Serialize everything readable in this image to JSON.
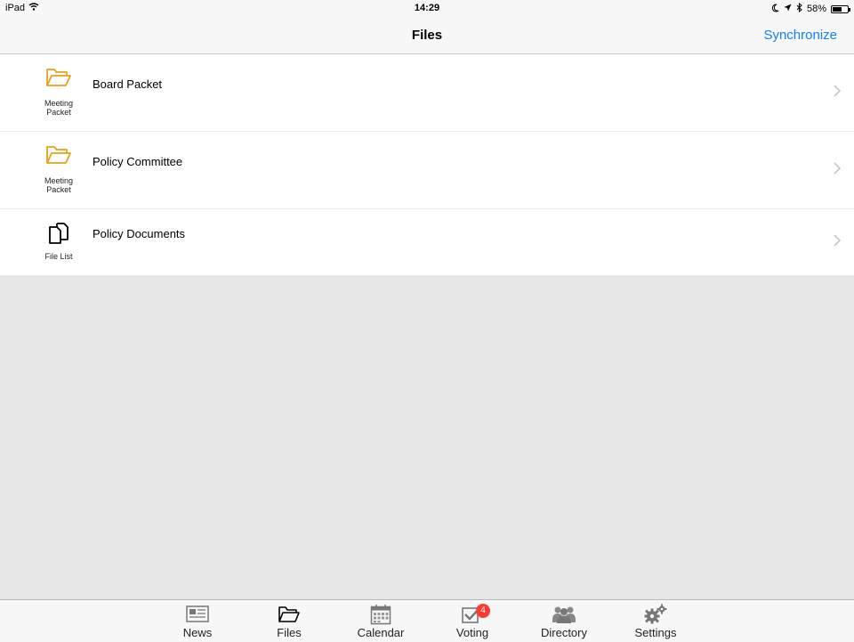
{
  "status_bar": {
    "device": "iPad",
    "time": "14:29",
    "battery": "58%",
    "battery_level": 0.58
  },
  "nav": {
    "title": "Files",
    "action_label": "Synchronize"
  },
  "colors": {
    "accent": "#157efb",
    "folder": "#e3a21a",
    "badge": "#ff3b30"
  },
  "items": [
    {
      "label": "Board Packet",
      "sublabel": "Meeting\nPacket",
      "icon": "folder-icon"
    },
    {
      "label": "Policy Committee",
      "sublabel": "Meeting\nPacket",
      "icon": "folder-icon"
    },
    {
      "label": "Policy Documents",
      "sublabel": "File List",
      "icon": "file-list-icon"
    }
  ],
  "tabs": [
    {
      "label": "News",
      "icon": "newspaper-icon"
    },
    {
      "label": "Files",
      "icon": "folder-icon"
    },
    {
      "label": "Calendar",
      "icon": "calendar-icon"
    },
    {
      "label": "Voting",
      "icon": "checkbox-icon",
      "badge": "4"
    },
    {
      "label": "Directory",
      "icon": "people-icon"
    },
    {
      "label": "Settings",
      "icon": "gears-icon"
    }
  ]
}
